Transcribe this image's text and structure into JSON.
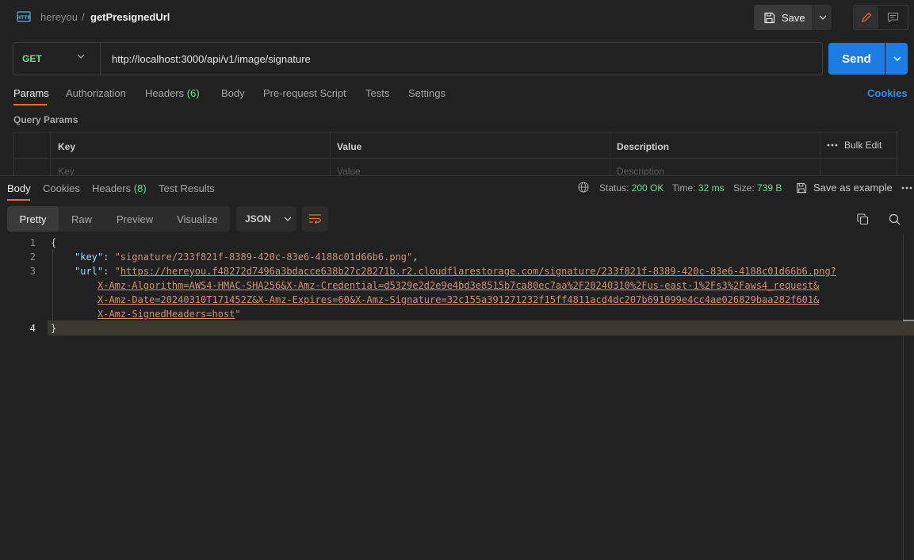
{
  "header": {
    "workspace": "hereyou",
    "separator": "/",
    "request_name": "getPresignedUrl",
    "save_label": "Save",
    "icons": [
      "http-icon",
      "save-icon",
      "chevron-down-icon",
      "pencil-icon",
      "comment-icon"
    ]
  },
  "request": {
    "method": "GET",
    "url": "http://localhost:3000/api/v1/image/signature",
    "send_label": "Send"
  },
  "request_tabs": {
    "params": "Params",
    "authorization": "Authorization",
    "headers": "Headers",
    "headers_count": "(6)",
    "body": "Body",
    "prerequest": "Pre-request Script",
    "tests": "Tests",
    "settings": "Settings",
    "cookies": "Cookies"
  },
  "query_params": {
    "title": "Query Params",
    "columns": {
      "key": "Key",
      "value": "Value",
      "description": "Description"
    },
    "bulk_edit": "Bulk Edit",
    "placeholders": {
      "key": "Key",
      "value": "Value",
      "description": "Description"
    }
  },
  "response_tabs": {
    "body": "Body",
    "cookies": "Cookies",
    "headers": "Headers",
    "headers_count": "(8)",
    "test_results": "Test Results"
  },
  "status": {
    "status_label": "Status:",
    "status_value": "200 OK",
    "time_label": "Time:",
    "time_value": "32 ms",
    "size_label": "Size:",
    "size_value": "739 B",
    "save_example": "Save as example"
  },
  "view": {
    "pretty": "Pretty",
    "raw": "Raw",
    "preview": "Preview",
    "visualize": "Visualize",
    "format": "JSON"
  },
  "code": {
    "line_numbers": [
      "1",
      "2",
      "3",
      "4"
    ],
    "open_brace": "{",
    "close_brace": "}",
    "key_name": "\"key\"",
    "key_value": "\"signature/233f821f-8389-420c-83e6-4188c01d66b6.png\"",
    "url_name": "\"url\"",
    "url_quote_open": "\"",
    "url_line1": "https://hereyou.f48272d7496a3bdacce638b27c28271b.r2.cloudflarestorage.com/signature/233f821f-8389-420c-83e6-4188c01d66b6.png?",
    "url_line2": "X-Amz-Algorithm=AWS4-HMAC-SHA256&X-Amz-Credential=d5329e2d2e9e4bd3e8515b7ca80ec7aa%2F20240310%2Fus-east-1%2Fs3%2Faws4_request&",
    "url_line3": "X-Amz-Date=20240310T171452Z&X-Amz-Expires=60&X-Amz-Signature=32c155a391271232f15ff4811acd4dc207b691099e4cc4ae026829baa282f601&",
    "url_line4": "X-Amz-SignedHeaders=host",
    "url_quote_close": "\""
  }
}
